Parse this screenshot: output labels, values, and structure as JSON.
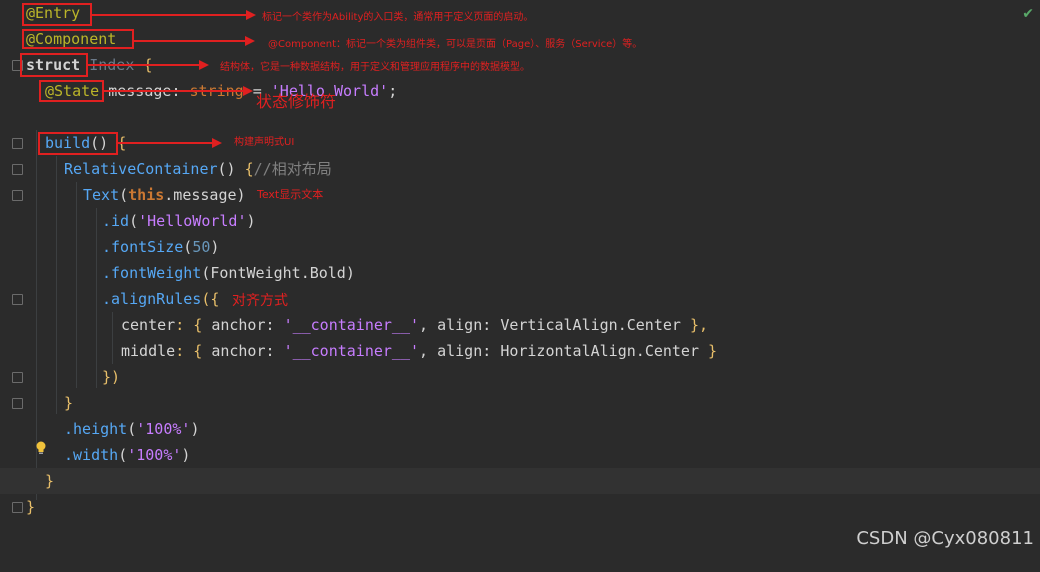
{
  "editor": {
    "lines": {
      "l1": "@Entry",
      "l2": "@Component",
      "l3_kw": "struct",
      "l3_name": " Index ",
      "l3_brace": "{",
      "l4_anno": "@State",
      "l4_rest_name": " message",
      "l4_colon": ": ",
      "l4_type": "string",
      "l4_eq": " = ",
      "l4_str": "'Hello World'",
      "l4_semi": ";",
      "l6_fn": "build",
      "l6_paren": "()",
      "l6_brace": " {",
      "l7_fn": "RelativeContainer",
      "l7_paren": "() ",
      "l7_brace": "{",
      "l7_comment": "//相对布局",
      "l8_fn": "Text",
      "l8_open": "(",
      "l8_this": "this",
      "l8_prop": ".message",
      "l8_close": ")",
      "l9_method": ".id",
      "l9_open": "(",
      "l9_str": "'HelloWorld'",
      "l9_close": ")",
      "l10_method": ".fontSize",
      "l10_open": "(",
      "l10_num": "50",
      "l10_close": ")",
      "l11_method": ".fontWeight",
      "l11_open": "(",
      "l11_arg": "FontWeight",
      "l11_dot": ".",
      "l11_val": "Bold",
      "l11_close": ")",
      "l12_method": ".alignRules",
      "l12_open": "({",
      "l13_key": "center",
      "l13_colon": ": { ",
      "l13_anchor": "anchor",
      "l13_colon2": ": ",
      "l13_str": "'__container__'",
      "l13_comma": ", ",
      "l13_align": "align",
      "l13_colon3": ": ",
      "l13_enum": "VerticalAlign",
      "l13_dot": ".",
      "l13_val": "Center",
      "l13_end": " },",
      "l14_key": "middle",
      "l14_colon": ": { ",
      "l14_anchor": "anchor",
      "l14_colon2": ": ",
      "l14_str": "'__container__'",
      "l14_comma": ", ",
      "l14_align": "align",
      "l14_colon3": ": ",
      "l14_enum": "HorizontalAlign",
      "l14_dot": ".",
      "l14_val": "Center",
      "l14_end": " }",
      "l15": "})",
      "l16": "}",
      "l17_method": ".height",
      "l17_open": "(",
      "l17_str": "'100%'",
      "l17_close": ")",
      "l18_method": ".width",
      "l18_open": "(",
      "l18_str": "'100%'",
      "l18_close": ")",
      "l19": "}",
      "l20": "}"
    }
  },
  "annotations": {
    "entry_note": "标记一个类作为Ability的入口类，通常用于定义页面的启动。",
    "component_note": "@Component：标记一个类为组件类，可以是页面（Page）、服务（Service）等。",
    "struct_note": "结构体，它是一种数据结构，用于定义和管理应用程序中的数据模型。",
    "state_note": "状态修饰符",
    "build_note": "构建声明式UI",
    "text_note": "Text显示文本",
    "align_note": "对齐方式"
  },
  "watermark": "CSDN @Cyx080811",
  "colors": {
    "background": "#2b2b2b",
    "annotation_red": "#e02020",
    "keyword": "#cc7832",
    "string": "#6a8759",
    "number": "#6897bb"
  }
}
